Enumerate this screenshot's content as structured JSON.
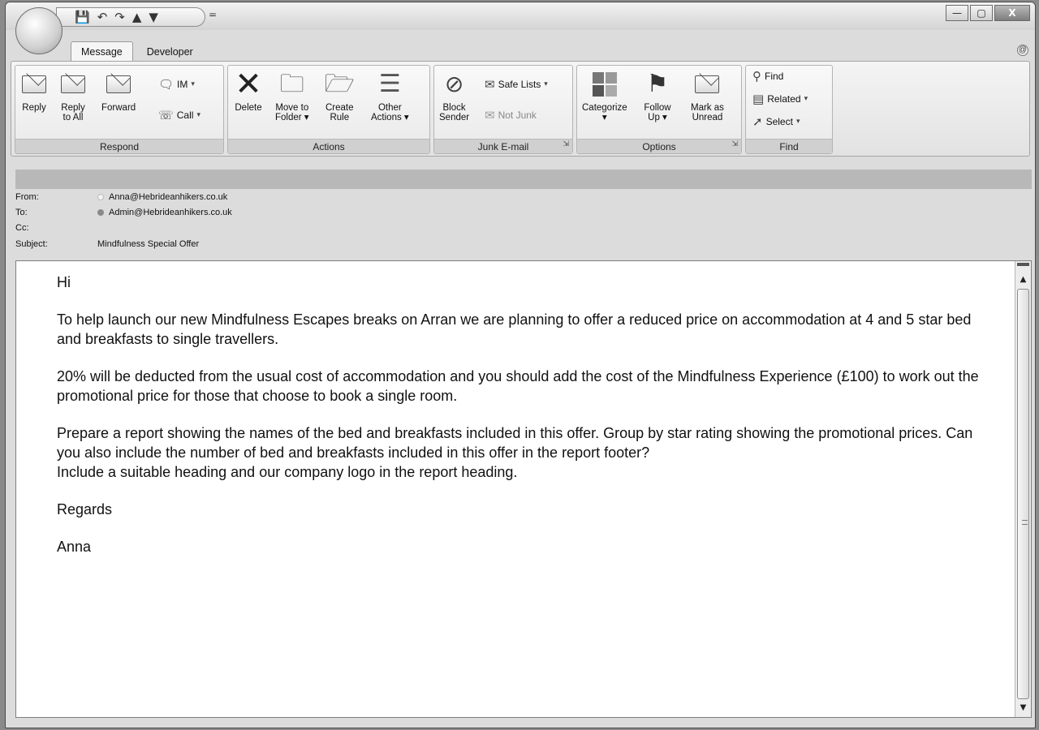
{
  "window": {
    "minimize": "—",
    "maximize": "▢",
    "close": "X"
  },
  "quick_access": {
    "save": "💾",
    "undo": "↶",
    "redo": "↷",
    "up": "▲",
    "down": "▼",
    "more": "="
  },
  "tabs": [
    {
      "label": "Message"
    },
    {
      "label": "Developer"
    }
  ],
  "help": "@",
  "ribbon": {
    "respond": {
      "label": "Respond",
      "reply": "Reply",
      "reply_all_1": "Reply",
      "reply_all_2": "to All",
      "forward": "Forward",
      "im": "IM",
      "call": "Call"
    },
    "actions": {
      "label": "Actions",
      "delete": "Delete",
      "move_1": "Move to",
      "move_2": "Folder",
      "create_1": "Create",
      "create_2": "Rule",
      "other_1": "Other",
      "other_2": "Actions"
    },
    "junk": {
      "label": "Junk E-mail",
      "block_1": "Block",
      "block_2": "Sender",
      "safe_lists": "Safe Lists",
      "not_junk": "Not Junk"
    },
    "options": {
      "label": "Options",
      "categorize": "Categorize",
      "follow_1": "Follow",
      "follow_2": "Up",
      "mark_1": "Mark as",
      "mark_2": "Unread"
    },
    "find": {
      "label": "Find",
      "find": "Find",
      "related": "Related",
      "select": "Select"
    }
  },
  "header": {
    "from_label": "From:",
    "from": "Anna@Hebrideanhikers.co.uk",
    "to_label": "To:",
    "to": "Admin@Hebrideanhikers.co.uk",
    "cc_label": "Cc:",
    "cc": "",
    "subject_label": "Subject:",
    "subject": "Mindfulness Special Offer"
  },
  "body": {
    "greeting": "Hi",
    "p1": "To help launch our new Mindfulness Escapes breaks on Arran we are planning to offer a reduced price on accommodation at 4 and 5 star bed and breakfasts to single travellers.",
    "p2": "20% will be deducted from the usual cost of accommodation and you should add the cost of the Mindfulness Experience (£100) to work out the promotional price for those that choose to book a single room.",
    "p3": "Prepare a report showing the names of the bed and breakfasts included in this offer.  Group by star rating showing the promotional prices.  Can you also include the number of bed and breakfasts included in this offer in the report footer?",
    "p4": "Include a suitable heading and our company logo in the report heading.",
    "closing": "Regards",
    "signature": "Anna"
  }
}
